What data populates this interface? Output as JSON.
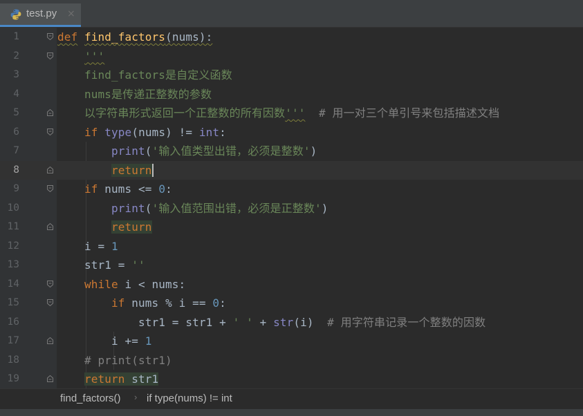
{
  "tab": {
    "label": "test.py",
    "icon": "python-file-icon",
    "close": "×"
  },
  "editor": {
    "current_line": 8,
    "lines": [
      {
        "n": "1"
      },
      {
        "n": "2"
      },
      {
        "n": "3"
      },
      {
        "n": "4"
      },
      {
        "n": "5"
      },
      {
        "n": "6"
      },
      {
        "n": "7"
      },
      {
        "n": "8"
      },
      {
        "n": "9"
      },
      {
        "n": "10"
      },
      {
        "n": "11"
      },
      {
        "n": "12"
      },
      {
        "n": "13"
      },
      {
        "n": "14"
      },
      {
        "n": "15"
      },
      {
        "n": "16"
      },
      {
        "n": "17"
      },
      {
        "n": "18"
      },
      {
        "n": "19"
      }
    ],
    "code": {
      "l1_kw": "def",
      "l1_fn": "find_factors",
      "l1_rest": "(nums):",
      "l2_doc": "'''",
      "l3_doc": "find_factors是自定义函数",
      "l4_doc": "nums是传递正整数的参数",
      "l5_doc": "以字符串形式返回一个正整数的所有因数",
      "l5_q": "'''",
      "l5_cmt": "# 用一对三个单引号来包括描述文档",
      "l6_if": "if",
      "l6_type": "type",
      "l6_mid": "(nums) != ",
      "l6_int": "int",
      "l6_end": ":",
      "l7_print": "print",
      "l7_open": "(",
      "l7_str": "'输入值类型出错，必须是整数'",
      "l7_close": ")",
      "l8_return": "return",
      "l9_if": "if",
      "l9_mid": " nums <= ",
      "l9_num": "0",
      "l9_end": ":",
      "l10_print": "print",
      "l10_open": "(",
      "l10_str": "'输入值范围出错，必须是正整数'",
      "l10_close": ")",
      "l11_return": "return",
      "l12_a": "i = ",
      "l12_num": "1",
      "l13_a": "str1 = ",
      "l13_str": "''",
      "l14_while": "while",
      "l14_rest": " i < nums:",
      "l15_if": "if",
      "l15_mid": " nums % i == ",
      "l15_num": "0",
      "l15_end": ":",
      "l16_a": "str1 = str1 + ",
      "l16_str": "' '",
      "l16_b": " + ",
      "l16_bi": "str",
      "l16_c": "(i)",
      "l16_cmt": "# 用字符串记录一个整数的因数",
      "l17_a": "i += ",
      "l17_num": "1",
      "l18_cmt": "# print(str1)",
      "l19_kw": "return",
      "l19_rest": " str1"
    }
  },
  "breadcrumb": {
    "items": [
      "find_factors()",
      "if type(nums) != int"
    ],
    "separator": "›"
  },
  "colors": {
    "background": "#2b2b2b",
    "gutter": "#313335",
    "keyword": "#cc7832",
    "function": "#ffc66d",
    "builtin": "#8888c6",
    "number": "#6897bb",
    "string": "#6a8759",
    "comment": "#808080",
    "text": "#a9b7c6"
  }
}
